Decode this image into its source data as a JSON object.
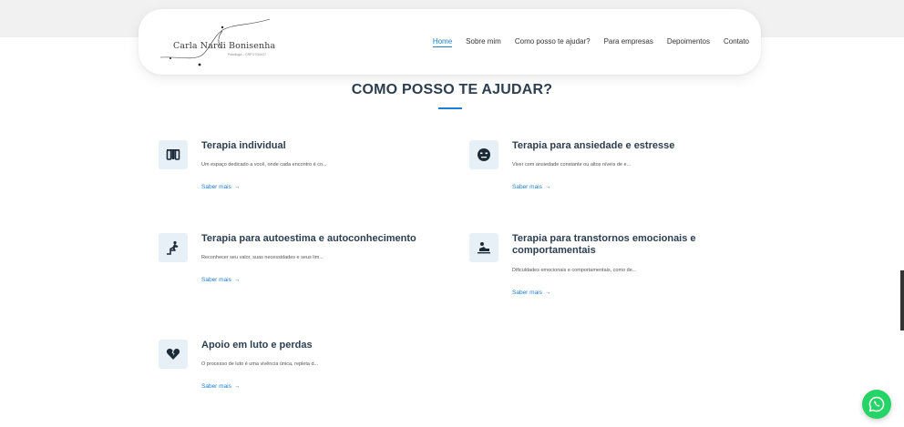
{
  "header": {
    "logo_name": "Carla Nardi Bonisenha",
    "logo_subtitle": "Psicóloga – CRP 07/34417"
  },
  "nav": {
    "items": [
      {
        "label": "Home",
        "active": true
      },
      {
        "label": "Sobre mim"
      },
      {
        "label": "Como posso te ajudar?"
      },
      {
        "label": "Para empresas"
      },
      {
        "label": "Depoimentos"
      },
      {
        "label": "Contato"
      }
    ]
  },
  "section": {
    "title": "COMO POSSO TE AJUDAR?",
    "accent_color": "#1a7fd4"
  },
  "services": [
    {
      "title": "Terapia individual",
      "description": "Um espaço dedicado a você, onde cada encontro é co...",
      "link": "Saber mais",
      "arrow": "→",
      "icon": "therapy-individual-icon"
    },
    {
      "title": "Terapia para ansiedade e estresse",
      "description": "Viver com ansiedade constante ou altos níveis de e...",
      "link": "Saber mais",
      "arrow": "→",
      "icon": "stressed-face-icon"
    },
    {
      "title": "Terapia para autoestima e autoconhecimento",
      "description": "Reconhecer seu valor, suas necessidades e seus lim...",
      "link": "Saber mais",
      "arrow": "→",
      "icon": "climbing-stairs-icon"
    },
    {
      "title": "Terapia para transtornos emocionais e comportamentais",
      "description": "Dificuldades emocionais e comportamentais, como de...",
      "link": "Saber mais",
      "arrow": "→",
      "icon": "person-lying-icon"
    },
    {
      "title": "Apoio em luto e perdas",
      "description": "O processo de luto é uma vivência única, repleta d...",
      "link": "Saber mais",
      "arrow": "→",
      "icon": "broken-heart-icon"
    }
  ],
  "whatsapp": {
    "icon": "whatsapp-icon",
    "color": "#25d366"
  }
}
